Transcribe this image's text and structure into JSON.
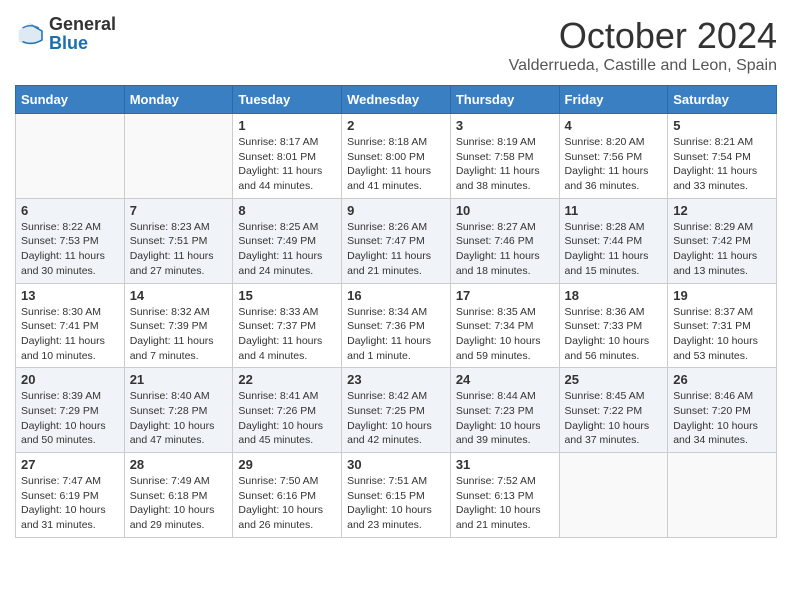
{
  "logo": {
    "general": "General",
    "blue": "Blue"
  },
  "title": "October 2024",
  "location": "Valderrueda, Castille and Leon, Spain",
  "days_header": [
    "Sunday",
    "Monday",
    "Tuesday",
    "Wednesday",
    "Thursday",
    "Friday",
    "Saturday"
  ],
  "weeks": [
    [
      {
        "day": "",
        "content": ""
      },
      {
        "day": "",
        "content": ""
      },
      {
        "day": "1",
        "content": "Sunrise: 8:17 AM\nSunset: 8:01 PM\nDaylight: 11 hours and 44 minutes."
      },
      {
        "day": "2",
        "content": "Sunrise: 8:18 AM\nSunset: 8:00 PM\nDaylight: 11 hours and 41 minutes."
      },
      {
        "day": "3",
        "content": "Sunrise: 8:19 AM\nSunset: 7:58 PM\nDaylight: 11 hours and 38 minutes."
      },
      {
        "day": "4",
        "content": "Sunrise: 8:20 AM\nSunset: 7:56 PM\nDaylight: 11 hours and 36 minutes."
      },
      {
        "day": "5",
        "content": "Sunrise: 8:21 AM\nSunset: 7:54 PM\nDaylight: 11 hours and 33 minutes."
      }
    ],
    [
      {
        "day": "6",
        "content": "Sunrise: 8:22 AM\nSunset: 7:53 PM\nDaylight: 11 hours and 30 minutes."
      },
      {
        "day": "7",
        "content": "Sunrise: 8:23 AM\nSunset: 7:51 PM\nDaylight: 11 hours and 27 minutes."
      },
      {
        "day": "8",
        "content": "Sunrise: 8:25 AM\nSunset: 7:49 PM\nDaylight: 11 hours and 24 minutes."
      },
      {
        "day": "9",
        "content": "Sunrise: 8:26 AM\nSunset: 7:47 PM\nDaylight: 11 hours and 21 minutes."
      },
      {
        "day": "10",
        "content": "Sunrise: 8:27 AM\nSunset: 7:46 PM\nDaylight: 11 hours and 18 minutes."
      },
      {
        "day": "11",
        "content": "Sunrise: 8:28 AM\nSunset: 7:44 PM\nDaylight: 11 hours and 15 minutes."
      },
      {
        "day": "12",
        "content": "Sunrise: 8:29 AM\nSunset: 7:42 PM\nDaylight: 11 hours and 13 minutes."
      }
    ],
    [
      {
        "day": "13",
        "content": "Sunrise: 8:30 AM\nSunset: 7:41 PM\nDaylight: 11 hours and 10 minutes."
      },
      {
        "day": "14",
        "content": "Sunrise: 8:32 AM\nSunset: 7:39 PM\nDaylight: 11 hours and 7 minutes."
      },
      {
        "day": "15",
        "content": "Sunrise: 8:33 AM\nSunset: 7:37 PM\nDaylight: 11 hours and 4 minutes."
      },
      {
        "day": "16",
        "content": "Sunrise: 8:34 AM\nSunset: 7:36 PM\nDaylight: 11 hours and 1 minute."
      },
      {
        "day": "17",
        "content": "Sunrise: 8:35 AM\nSunset: 7:34 PM\nDaylight: 10 hours and 59 minutes."
      },
      {
        "day": "18",
        "content": "Sunrise: 8:36 AM\nSunset: 7:33 PM\nDaylight: 10 hours and 56 minutes."
      },
      {
        "day": "19",
        "content": "Sunrise: 8:37 AM\nSunset: 7:31 PM\nDaylight: 10 hours and 53 minutes."
      }
    ],
    [
      {
        "day": "20",
        "content": "Sunrise: 8:39 AM\nSunset: 7:29 PM\nDaylight: 10 hours and 50 minutes."
      },
      {
        "day": "21",
        "content": "Sunrise: 8:40 AM\nSunset: 7:28 PM\nDaylight: 10 hours and 47 minutes."
      },
      {
        "day": "22",
        "content": "Sunrise: 8:41 AM\nSunset: 7:26 PM\nDaylight: 10 hours and 45 minutes."
      },
      {
        "day": "23",
        "content": "Sunrise: 8:42 AM\nSunset: 7:25 PM\nDaylight: 10 hours and 42 minutes."
      },
      {
        "day": "24",
        "content": "Sunrise: 8:44 AM\nSunset: 7:23 PM\nDaylight: 10 hours and 39 minutes."
      },
      {
        "day": "25",
        "content": "Sunrise: 8:45 AM\nSunset: 7:22 PM\nDaylight: 10 hours and 37 minutes."
      },
      {
        "day": "26",
        "content": "Sunrise: 8:46 AM\nSunset: 7:20 PM\nDaylight: 10 hours and 34 minutes."
      }
    ],
    [
      {
        "day": "27",
        "content": "Sunrise: 7:47 AM\nSunset: 6:19 PM\nDaylight: 10 hours and 31 minutes."
      },
      {
        "day": "28",
        "content": "Sunrise: 7:49 AM\nSunset: 6:18 PM\nDaylight: 10 hours and 29 minutes."
      },
      {
        "day": "29",
        "content": "Sunrise: 7:50 AM\nSunset: 6:16 PM\nDaylight: 10 hours and 26 minutes."
      },
      {
        "day": "30",
        "content": "Sunrise: 7:51 AM\nSunset: 6:15 PM\nDaylight: 10 hours and 23 minutes."
      },
      {
        "day": "31",
        "content": "Sunrise: 7:52 AM\nSunset: 6:13 PM\nDaylight: 10 hours and 21 minutes."
      },
      {
        "day": "",
        "content": ""
      },
      {
        "day": "",
        "content": ""
      }
    ]
  ]
}
